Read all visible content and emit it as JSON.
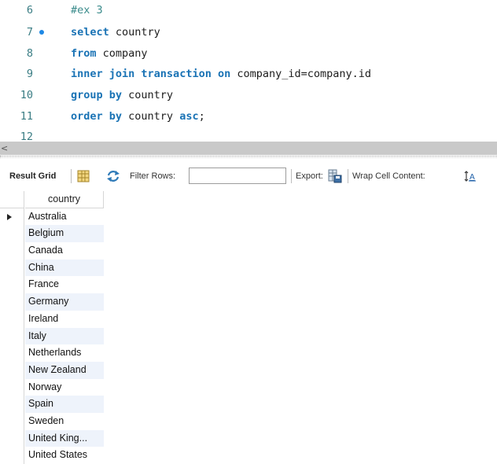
{
  "editor": {
    "lines": [
      {
        "num": "6",
        "text": "#ex 3"
      },
      {
        "num": "7",
        "kw1": "select",
        "rest1": " country"
      },
      {
        "num": "8",
        "kw1": "from",
        "rest1": " company"
      },
      {
        "num": "9",
        "kw1": "inner join",
        "rest1": " ",
        "kw2": "transaction",
        "rest2": " ",
        "kw3": "on",
        "rest3": " company_id=company.id"
      },
      {
        "num": "10",
        "kw1": "group by",
        "rest1": " country"
      },
      {
        "num": "11",
        "kw1": "order by",
        "rest1": " country ",
        "kw2": "asc",
        "rest2": ";"
      },
      {
        "num": "12"
      }
    ]
  },
  "splitter": {
    "arrow": "<"
  },
  "toolbar": {
    "result_grid_label": "Result Grid",
    "filter_label": "Filter Rows:",
    "filter_value": "",
    "export_label": "Export:",
    "wrap_label": "Wrap Cell Content:"
  },
  "grid": {
    "column": "country",
    "rows": [
      "Australia",
      "Belgium",
      "Canada",
      "China",
      "France",
      "Germany",
      "Ireland",
      "Italy",
      "Netherlands",
      "New Zealand",
      "Norway",
      "Spain",
      "Sweden",
      "United King...",
      "United States"
    ]
  },
  "colors": {
    "keyword": "#1a73b5",
    "line_number": "#3a7d84",
    "breakpoint": "#1e88e5",
    "row_alt": "#eef3fb"
  }
}
